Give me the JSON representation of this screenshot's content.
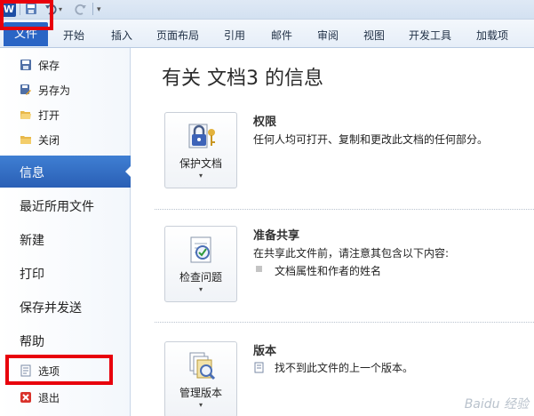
{
  "qat": {
    "app_icon": "W",
    "icons": [
      "word-app-icon",
      "save-icon",
      "undo-icon",
      "redo-icon",
      "customize-dropdown-icon"
    ]
  },
  "ribbon": {
    "file_tab": "文件",
    "tabs": [
      "开始",
      "插入",
      "页面布局",
      "引用",
      "邮件",
      "审阅",
      "视图",
      "开发工具",
      "加载项"
    ],
    "highlight_color": "#e8000c",
    "file_tab_color": "#2a65c5"
  },
  "nav": {
    "commands_top": [
      "保存",
      "另存为",
      "打开",
      "关闭"
    ],
    "items": [
      "信息",
      "最近所用文件",
      "新建",
      "打印",
      "保存并发送",
      "帮助"
    ],
    "commands_bottom": [
      "选项",
      "退出"
    ],
    "selected": "信息",
    "selected_color": "#2a5fb5"
  },
  "main": {
    "title": "有关 文档3 的信息",
    "sections": [
      {
        "button": "保护文档",
        "title": "权限",
        "desc": "任何人均可打开、复制和更改此文档的任何部分。",
        "icon": "lock-key-icon"
      },
      {
        "button": "检查问题",
        "title": "准备共享",
        "desc": "在共享此文件前，请注意其包含以下内容:",
        "bullets": [
          "文档属性和作者的姓名"
        ],
        "icon": "checklist-icon"
      },
      {
        "button": "管理版本",
        "title": "版本",
        "desc": "找不到此文件的上一个版本。",
        "icon": "versions-icon"
      }
    ]
  },
  "watermark": "Baidu 经验"
}
